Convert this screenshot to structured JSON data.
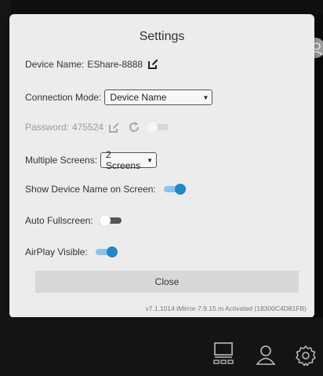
{
  "dialog": {
    "title": "Settings",
    "device_name_label": "Device Name:",
    "device_name_value": "EShare-8888",
    "connection_mode_label": "Connection Mode:",
    "connection_mode_value": "Device Name",
    "password_label": "Password:",
    "password_value": "475524",
    "multiple_screens_label": "Multiple Screens:",
    "multiple_screens_value": "2 Screens",
    "show_device_name_label": "Show Device Name on Screen:",
    "show_device_name_on": true,
    "auto_fullscreen_label": "Auto Fullscreen:",
    "auto_fullscreen_on": false,
    "airplay_visible_label": "AirPlay Visible:",
    "airplay_visible_on": true,
    "password_toggle_enabled": false,
    "close_label": "Close",
    "version_text": "v7.1.1014 iMirror-7.9.15.m Activated (18300C4D81FB)"
  },
  "icons": {
    "edit": "edit-icon",
    "refresh": "refresh-icon",
    "screens": "screens-icon",
    "user": "user-icon",
    "settings": "gear-icon"
  },
  "colors": {
    "accent": "#2485c9",
    "accent_track": "#8bc4e8",
    "dialog_bg": "#ececec",
    "background": "#0b0b0c"
  }
}
